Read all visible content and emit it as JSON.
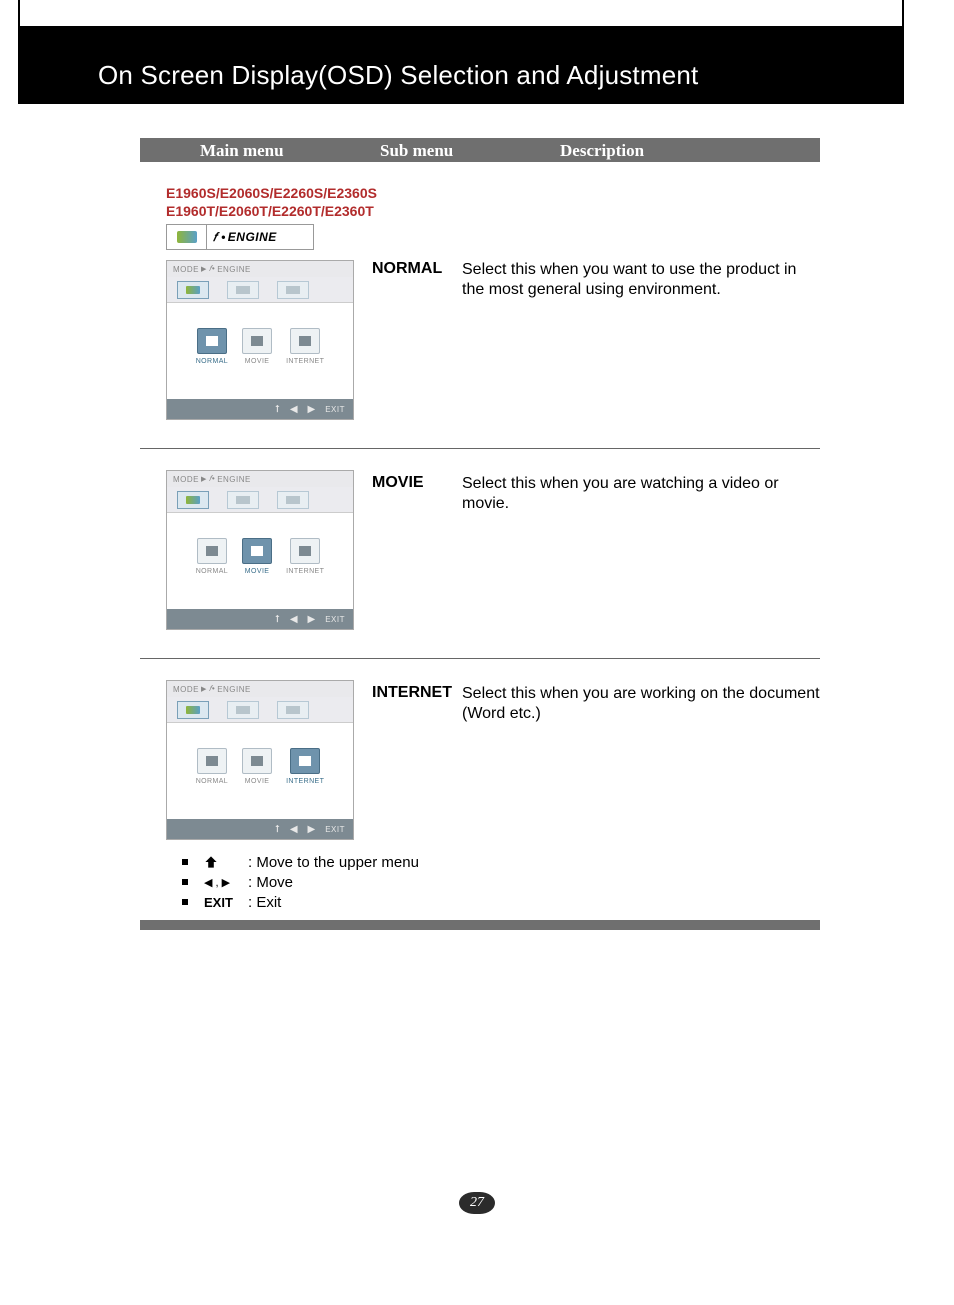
{
  "title": "On Screen Display(OSD) Selection and Adjustment",
  "columns": {
    "main": "Main menu",
    "sub": "Sub menu",
    "desc": "Description"
  },
  "models": {
    "line1": "E1960S/E2060S/E2260S/E2360S",
    "line2": "E1960T/E2060T/E2260T/E2360T"
  },
  "engine_label": "ENGINE",
  "osd": {
    "breadcrumb_mode": "MODE",
    "breadcrumb_engine": "ENGINE",
    "items": {
      "normal": "NORMAL",
      "movie": "MOVIE",
      "internet": "INTERNET"
    },
    "exit": "EXIT"
  },
  "rows": [
    {
      "sub": "NORMAL",
      "desc": "Select this when you want to use the product in the most general using environment."
    },
    {
      "sub": "MOVIE",
      "desc": "Select this when you are watching a video or movie."
    },
    {
      "sub": "INTERNET",
      "desc": "Select this when you are working on the document (Word etc.)"
    }
  ],
  "legend": {
    "up": ": Move to the upper menu",
    "move": ": Move",
    "exit_label": "EXIT",
    "exit": ": Exit"
  },
  "page_number": "27"
}
